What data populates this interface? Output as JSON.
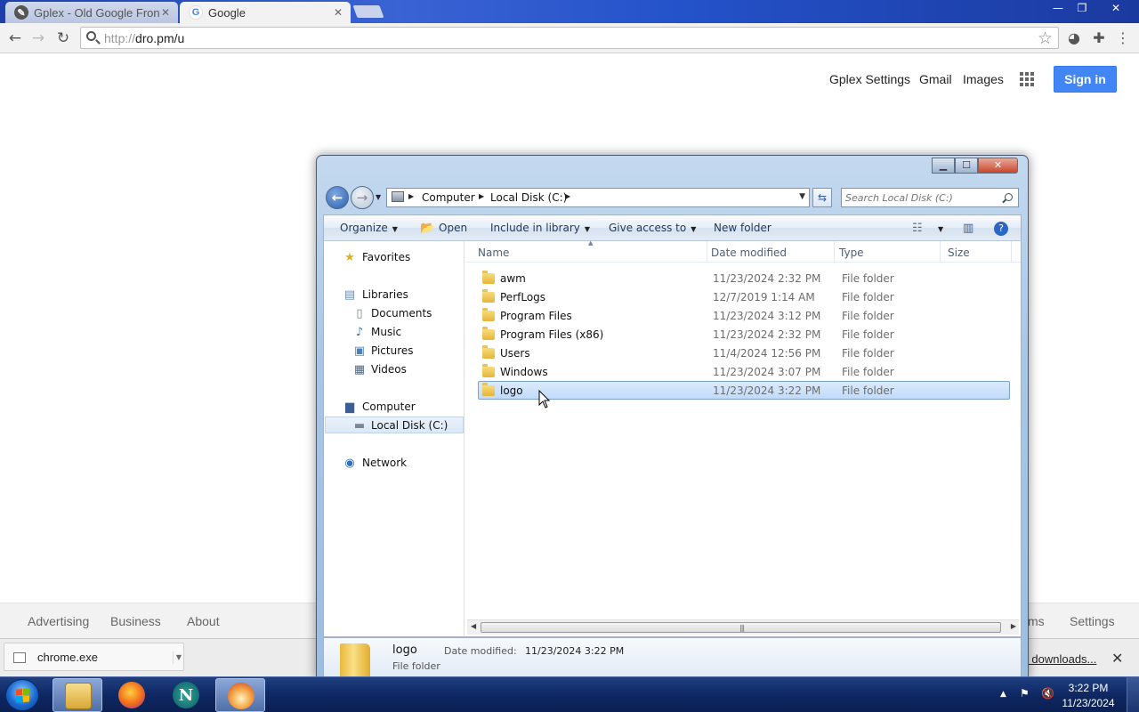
{
  "browser": {
    "tabs": [
      {
        "title": "Gplex - Old Google Fronte",
        "close": "✕"
      },
      {
        "title": "Google",
        "close": "✕"
      }
    ],
    "url_prefix": "http://",
    "url_host": "dro.pm/u",
    "window_controls": {
      "minimize": "—",
      "maximize": "❐",
      "close": "✕"
    }
  },
  "google_page": {
    "header_links": [
      "Gplex Settings",
      "Gmail",
      "Images"
    ],
    "signin_label": "Sign in",
    "footer_left": [
      "Advertising",
      "Business",
      "About"
    ],
    "footer_right_partial": "ms",
    "footer_settings": "Settings",
    "accent_color": "#4285f4"
  },
  "download_bar": {
    "file_name": "chrome.exe",
    "show_all_partial": "ll downloads...",
    "close": "✕"
  },
  "explorer": {
    "window_controls": {
      "minimize": "▁",
      "maximize": "☐",
      "close": "✕"
    },
    "breadcrumb": [
      "Computer",
      "Local Disk (C:)"
    ],
    "search_placeholder": "Search Local Disk (C:)",
    "commands": {
      "organize": "Organize",
      "open": "Open",
      "include": "Include in library",
      "share": "Give access to",
      "new_folder": "New folder"
    },
    "nav_pane": {
      "favorites": "Favorites",
      "libraries": "Libraries",
      "documents": "Documents",
      "music": "Music",
      "pictures": "Pictures",
      "videos": "Videos",
      "computer": "Computer",
      "local_disk": "Local Disk (C:)",
      "network": "Network"
    },
    "columns": [
      "Name",
      "Date modified",
      "Type",
      "Size"
    ],
    "files": [
      {
        "name": "awm",
        "date": "11/23/2024 2:32 PM",
        "type": "File folder"
      },
      {
        "name": "PerfLogs",
        "date": "12/7/2019 1:14 AM",
        "type": "File folder"
      },
      {
        "name": "Program Files",
        "date": "11/23/2024 3:12 PM",
        "type": "File folder"
      },
      {
        "name": "Program Files (x86)",
        "date": "11/23/2024 2:32 PM",
        "type": "File folder"
      },
      {
        "name": "Users",
        "date": "11/4/2024 12:56 PM",
        "type": "File folder"
      },
      {
        "name": "Windows",
        "date": "11/23/2024 3:07 PM",
        "type": "File folder"
      },
      {
        "name": "logo",
        "date": "11/23/2024 3:22 PM",
        "type": "File folder"
      }
    ],
    "selected_file": "logo",
    "details": {
      "name": "logo",
      "type": "File folder",
      "date_label": "Date modified:",
      "date_value": "11/23/2024 3:22 PM"
    }
  },
  "taskbar": {
    "time": "3:22 PM",
    "date": "11/23/2024",
    "apps": [
      "explorer-icon",
      "firefox-icon",
      "netscape-icon",
      "flame-app-icon"
    ]
  }
}
